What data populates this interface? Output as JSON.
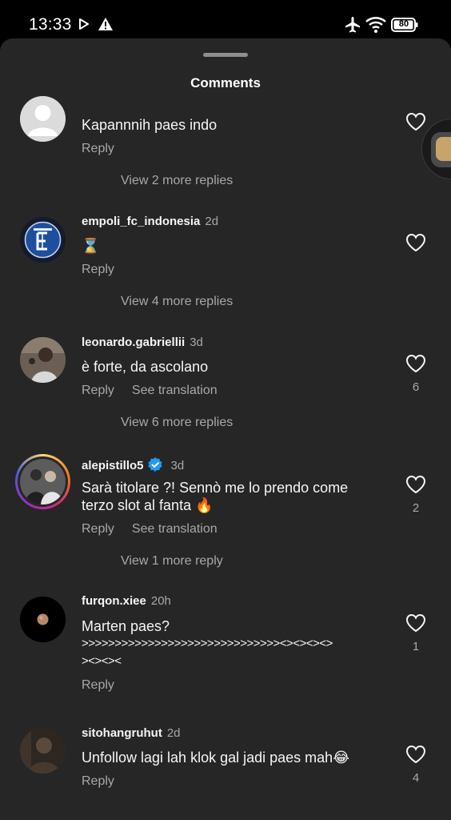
{
  "status_bar": {
    "time": "13:33",
    "battery": "80",
    "icons": [
      "play-icon",
      "warning-icon",
      "airplane-icon",
      "wifi-icon",
      "battery-icon"
    ]
  },
  "sheet": {
    "title": "Comments"
  },
  "comments": [
    {
      "username": "",
      "time": "",
      "text": "Kapannnih paes indo",
      "actions": [
        "Reply"
      ],
      "likes": "",
      "view_replies": "View 2 more replies"
    },
    {
      "username": "empoli_fc_indonesia",
      "time": "2d",
      "text": "⌛",
      "actions": [
        "Reply"
      ],
      "likes": "",
      "view_replies": "View 4 more replies"
    },
    {
      "username": "leonardo.gabriellii",
      "time": "3d",
      "text": "è forte, da ascolano",
      "actions": [
        "Reply",
        "See translation"
      ],
      "likes": "6",
      "view_replies": "View 6 more replies"
    },
    {
      "username": "alepistillo5",
      "time": "3d",
      "verified": true,
      "text_lines": [
        "Sarà titolare ?! Sennò me lo prendo come",
        "terzo slot al fanta 🔥"
      ],
      "actions": [
        "Reply",
        "See translation"
      ],
      "likes": "2",
      "view_replies": "View 1 more reply"
    },
    {
      "username": "furqon.xiee",
      "time": "20h",
      "text_lines": [
        "Marten paes?",
        ">>>>>>>>>>>>>>>>>>>>>>>>>>>>>><><><><>",
        "><><><"
      ],
      "actions": [
        "Reply"
      ],
      "likes": "1",
      "view_replies": ""
    },
    {
      "username": "sitohangruhut",
      "time": "2d",
      "text": "Unfollow lagi lah klok gal jadi paes mah😂",
      "actions": [
        "Reply"
      ],
      "likes": "4",
      "view_replies": ""
    }
  ],
  "colors": {
    "background": "#262626",
    "secondary_text": "#a8a8a8",
    "verified": "#1d9bf0",
    "story_ring": "#d62976"
  }
}
